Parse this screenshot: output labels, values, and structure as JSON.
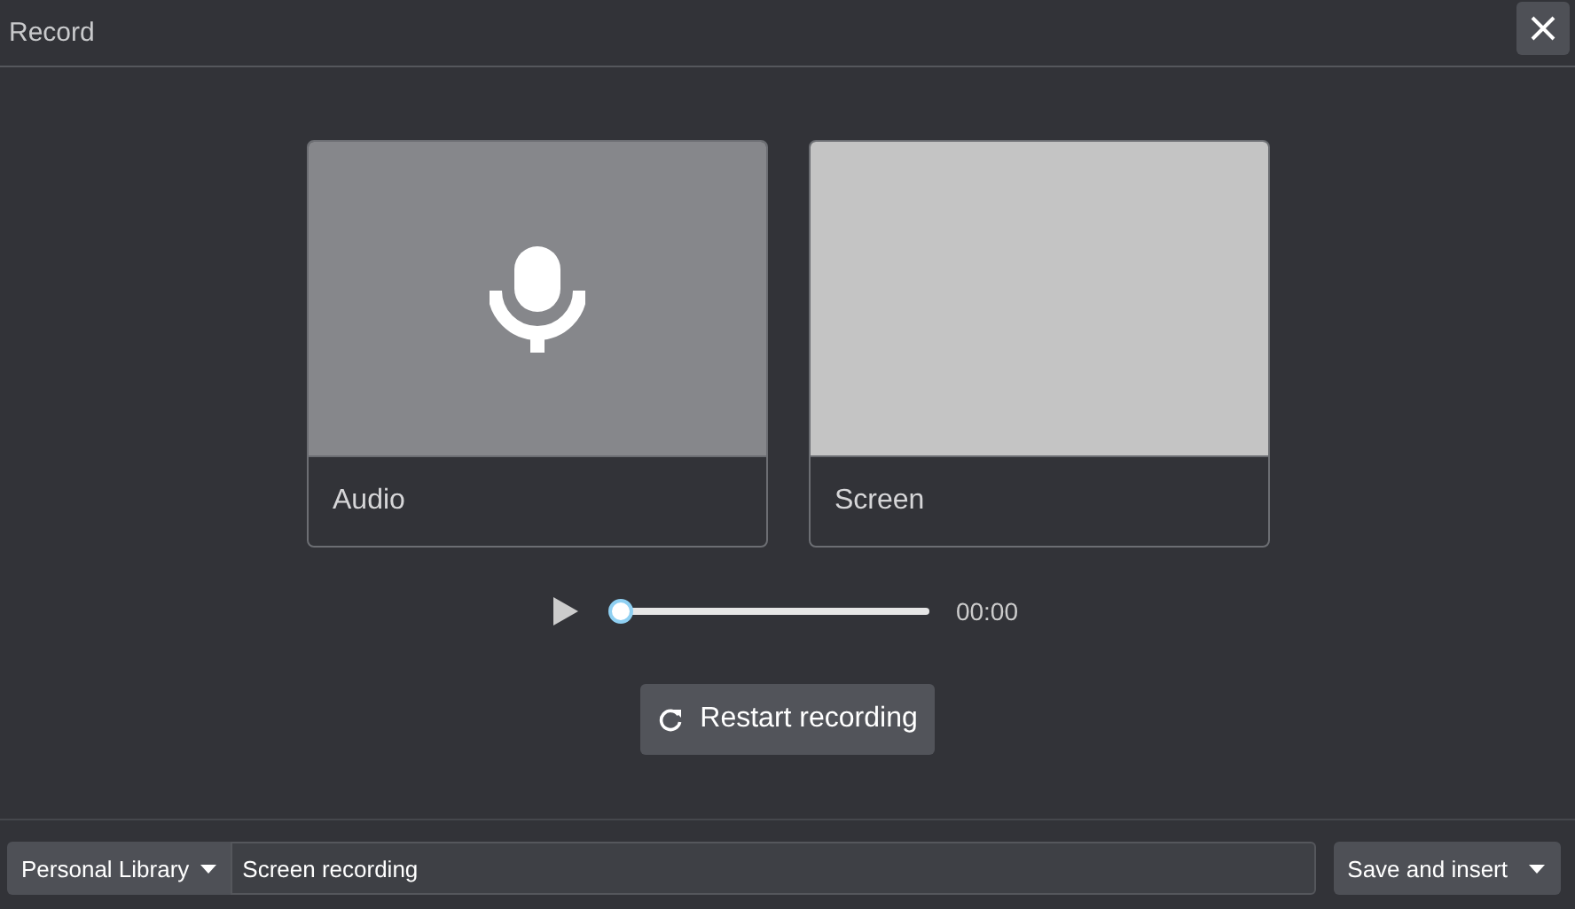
{
  "window": {
    "title": "Record"
  },
  "sources": [
    {
      "kind": "audio",
      "label": "Audio"
    },
    {
      "kind": "screen",
      "label": "Screen"
    }
  ],
  "player": {
    "level": 0,
    "time": "00:00"
  },
  "restart_button": {
    "label": "Restart recording"
  },
  "footer": {
    "library": "Personal Library",
    "name_value": "Screen recording",
    "save_button": "Save and insert"
  }
}
